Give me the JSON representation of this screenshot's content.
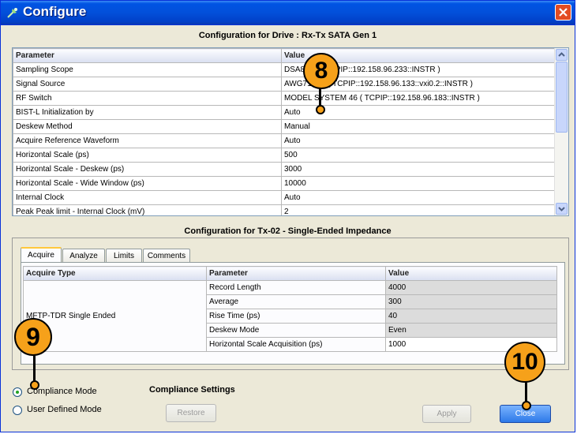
{
  "window": {
    "title": "Configure"
  },
  "drive_config": {
    "title": "Configuration for Drive : Rx-Tx SATA Gen 1",
    "columns": [
      "Parameter",
      "Value"
    ],
    "rows": [
      {
        "parameter": "Sampling Scope",
        "value": "DSA8200 ( TCPIP::192.158.96.233::INSTR )"
      },
      {
        "parameter": "Signal Source",
        "value": "AWG7122B ( TCPIP::192.158.96.133::vxi0.2::INSTR )"
      },
      {
        "parameter": "RF Switch",
        "value": "MODEL SYSTEM 46 ( TCPIP::192.158.96.183::INSTR )"
      },
      {
        "parameter": "BIST-L Initialization by",
        "value": "Auto"
      },
      {
        "parameter": "Deskew Method",
        "value": "Manual"
      },
      {
        "parameter": "Acquire Reference Waveform",
        "value": "Auto"
      },
      {
        "parameter": "Horizontal Scale (ps)",
        "value": "500"
      },
      {
        "parameter": "Horizontal Scale  - Deskew (ps)",
        "value": "3000"
      },
      {
        "parameter": "Horizontal Scale - Wide Window (ps)",
        "value": "10000"
      },
      {
        "parameter": "Internal Clock",
        "value": "Auto"
      },
      {
        "parameter": "Peak Peak limit - Internal Clock (mV)",
        "value": "2"
      }
    ]
  },
  "test_config": {
    "title": "Configuration for Tx-02 - Single-Ended Impedance",
    "tabs": [
      "Acquire",
      "Analyze",
      "Limits",
      "Comments"
    ],
    "active_tab": "Acquire",
    "columns": [
      "Acquire Type",
      "Parameter",
      "Value"
    ],
    "acquire_type": "MFTP-TDR Single Ended",
    "rows": [
      {
        "parameter": "Record Length",
        "value": "4000"
      },
      {
        "parameter": "Average",
        "value": "300"
      },
      {
        "parameter": "Rise Time (ps)",
        "value": "40"
      },
      {
        "parameter": "Deskew Mode",
        "value": "Even"
      },
      {
        "parameter": "Horizontal Scale Acquisition (ps)",
        "value": "1000"
      }
    ]
  },
  "modes": {
    "compliance": "Compliance Mode",
    "user_defined": "User Defined Mode",
    "selected": "compliance"
  },
  "compliance_settings_label": "Compliance Settings",
  "buttons": {
    "restore": "Restore",
    "apply": "Apply",
    "close": "Close"
  },
  "callouts": [
    "8",
    "9",
    "10"
  ],
  "colors": {
    "title_bar": "#0054e3",
    "callout_fill": "#f6a11a",
    "dialog_bg": "#ece9d8"
  }
}
